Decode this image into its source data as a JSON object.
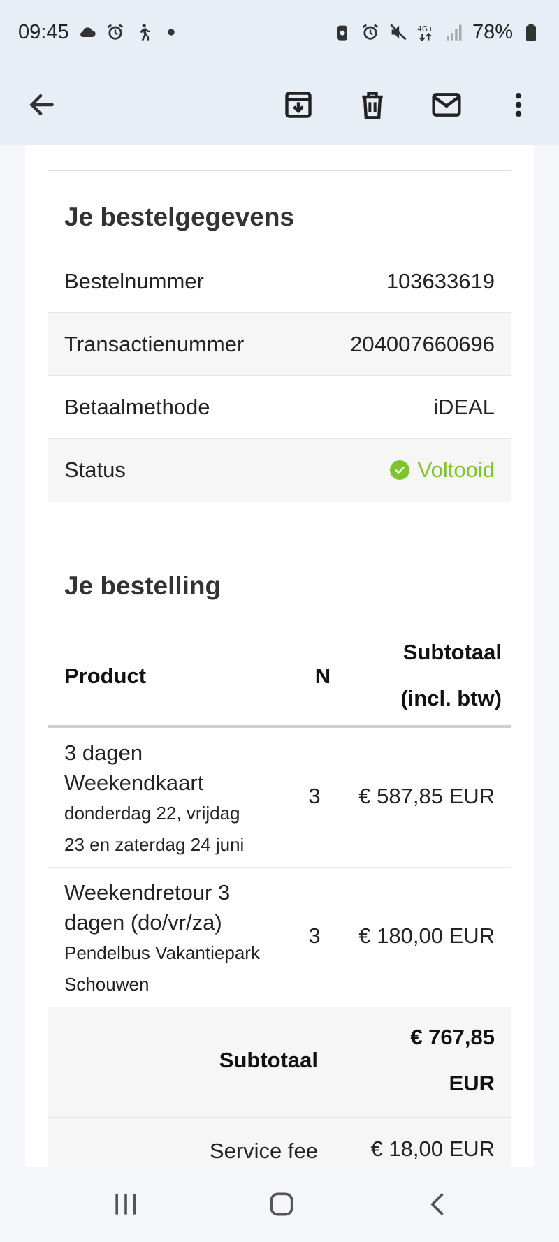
{
  "status_bar": {
    "time": "09:45",
    "battery": "78%",
    "network": "4G+"
  },
  "app_bar": {
    "back_icon": "arrow-left",
    "archive_icon": "archive-down",
    "delete_icon": "trash",
    "mail_icon": "envelope",
    "more_icon": "dots-vertical"
  },
  "order_details": {
    "title": "Je bestelgegevens",
    "rows": [
      {
        "label": "Bestelnummer",
        "value": "103633619"
      },
      {
        "label": "Transactienummer",
        "value": "204007660696"
      },
      {
        "label": "Betaalmethode",
        "value": "iDEAL"
      },
      {
        "label": "Status",
        "value": "Voltooid"
      }
    ],
    "status_color": "#7cc52b"
  },
  "order": {
    "title": "Je bestelling",
    "headers": {
      "product": "Product",
      "qty": "N",
      "subtotal_line1": "Subtotaal",
      "subtotal_line2": "(incl. btw)"
    },
    "items": [
      {
        "name_line1": "3 dagen",
        "name_line2": "Weekendkaart",
        "sub_line1": "donderdag 22, vrijdag",
        "sub_line2": "23 en zaterdag 24 juni",
        "qty": "3",
        "price": "€ 587,85 EUR"
      },
      {
        "name_line1": "Weekendretour 3",
        "name_line2": "dagen (do/vr/za)",
        "sub_line1": "Pendelbus Vakantiepark",
        "sub_line2": "Schouwen",
        "qty": "3",
        "price": "€ 180,00 EUR"
      }
    ],
    "subtotal": {
      "label": "Subtotaal",
      "value_line1": "€ 767,85",
      "value_line2": "EUR"
    },
    "service_fee": {
      "label": "Service fee",
      "value": "€ 18,00 EUR"
    }
  }
}
